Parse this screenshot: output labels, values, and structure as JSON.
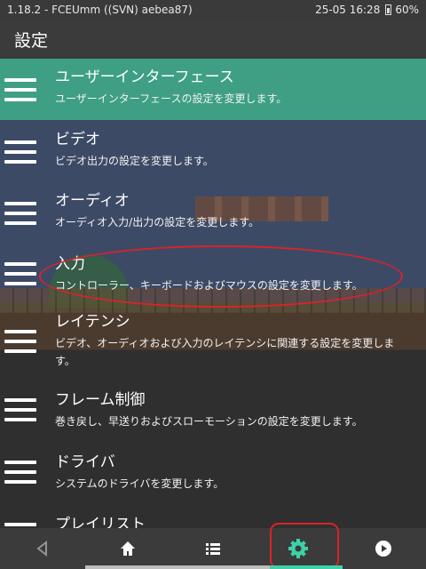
{
  "status_bar": {
    "left_text": "1.18.2 - FCEUmm ((SVN) aebea87)",
    "datetime": "25-05 16:28",
    "battery": "60%"
  },
  "title_bar": {
    "title": "設定"
  },
  "menu": {
    "items": [
      {
        "title": "ユーザーインターフェース",
        "description": "ユーザーインターフェースの設定を変更します。",
        "selected": true
      },
      {
        "title": "ビデオ",
        "description": "ビデオ出力の設定を変更します。"
      },
      {
        "title": "オーディオ",
        "description": "オーディオ入力/出力の設定を変更します。"
      },
      {
        "title": "入力",
        "description": "コントローラー、キーボードおよびマウスの設定を変更します。"
      },
      {
        "title": "レイテンシ",
        "description": "ビデオ、オーディオおよび入力のレイテンシに関連する設定を変更します。"
      },
      {
        "title": "フレーム制御",
        "description": "巻き戻し、早送りおよびスローモーションの設定を変更します。"
      },
      {
        "title": "ドライバ",
        "description": "システムのドライバを変更します。"
      },
      {
        "title": "プレイリスト",
        "description": ""
      }
    ]
  },
  "nav": {
    "icons": [
      "back-icon",
      "home-icon",
      "playlist-icon",
      "settings-icon",
      "run-icon"
    ],
    "active_color": "#3ed1a8"
  },
  "annotation_color": "#d8232a"
}
